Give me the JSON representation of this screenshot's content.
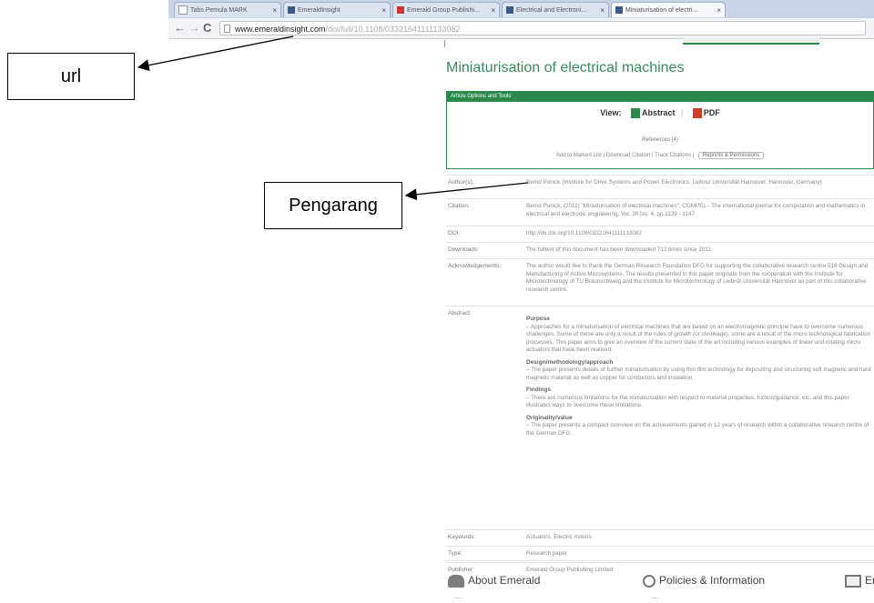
{
  "browser": {
    "tabs": [
      {
        "label": "Tabs Pemula MARK"
      },
      {
        "label": "EmeraldInsight"
      },
      {
        "label": "Emerald Group Publishi..."
      },
      {
        "label": "Electrical and Electroni..."
      },
      {
        "label": "Miniaturisation of electri..."
      }
    ],
    "url_host": "www.emeraldinsight.com",
    "url_path": "/doi/full/10.1108/03321641111133082"
  },
  "annotations": {
    "url_label": "url",
    "author_label": "Pengarang"
  },
  "article": {
    "title": "Miniaturisation of electrical machines",
    "options_header": "Article Options and Tools",
    "view_label": "View:",
    "abstract_link": "Abstract",
    "pdf_link": "PDF",
    "references_link": "References (4)",
    "tools": "Add to Marked List | Download Citation | Track Citations |",
    "reprints_button": "Reprints & Permissions",
    "fields": {
      "author_label": "Author(s):",
      "author_value": "Bernd Ponick (Institute for Drive Systems and Power Electronics, Leibniz Universität Hannover, Hannover, Germany)",
      "citation_label": "Citation:",
      "citation_value": "Bernd Ponick, (2011) \"Miniaturisation of electrical machines\", COMPEL - The international journal for computation and mathematics in electrical and electronic engineering, Vol. 30 Iss: 4, pp.1139 - 1147",
      "doi_label": "DOI:",
      "doi_value": "http://dx.doi.org/10.1108/03321641111133082",
      "downloads_label": "Downloads:",
      "downloads_value": "The fulltext of this document has been downloaded 712 times since 2011",
      "ack_label": "Acknowledgements:",
      "ack_value": "The author would like to thank the German Research Foundation DFG for supporting the collaborative research centre 516 Design and Manufacturing of Active Microsystems. The results presented in this paper originate from the cooperation with the Institute for Microtechnology of TU Braunschweig and the Institute for Microtechnology of Leibniz-Universität Hannover as part of this collaborative research centre.",
      "abstract_label": "Abstract:",
      "abstract": {
        "purpose_h": "Purpose",
        "purpose": "– Approaches for a miniaturisation of electrical machines that are based on an electromagnetic principle have to overcome numerous challenges. Some of these are only a result of the rules of growth (or shrinkage), some are a result of the micro technological fabrication processes. This paper aims to give an overview of the current state of the art including various examples of linear and rotating micro actuators that have been realised.",
        "design_h": "Design/methodology/approach",
        "design": "– The paper presents details of further miniaturisation by using thin film technology for depositing and structuring soft magnetic and hard magnetic material as well as copper for conductors and insulation.",
        "findings_h": "Findings",
        "findings": "– There are numerous limitations for the miniaturisation with respect to material properties, friction/guidance, etc. and this paper illustrates ways to overcome these limitations.",
        "orig_h": "Originality/value",
        "orig": "– The paper presents a compact overview on the achievements gained in 12 years of research within a collaborative research centre of the German DFG."
      },
      "keywords_label": "Keywords:",
      "keywords_value": "Actuators, Electric motors",
      "type_label": "Type:",
      "type_value": "Research paper",
      "publisher_label": "Publisher:",
      "publisher_value": "Emerald Group Publishing Limited"
    }
  },
  "footer": {
    "about": "About Emerald",
    "policies": "Policies & Information",
    "third": "En"
  }
}
